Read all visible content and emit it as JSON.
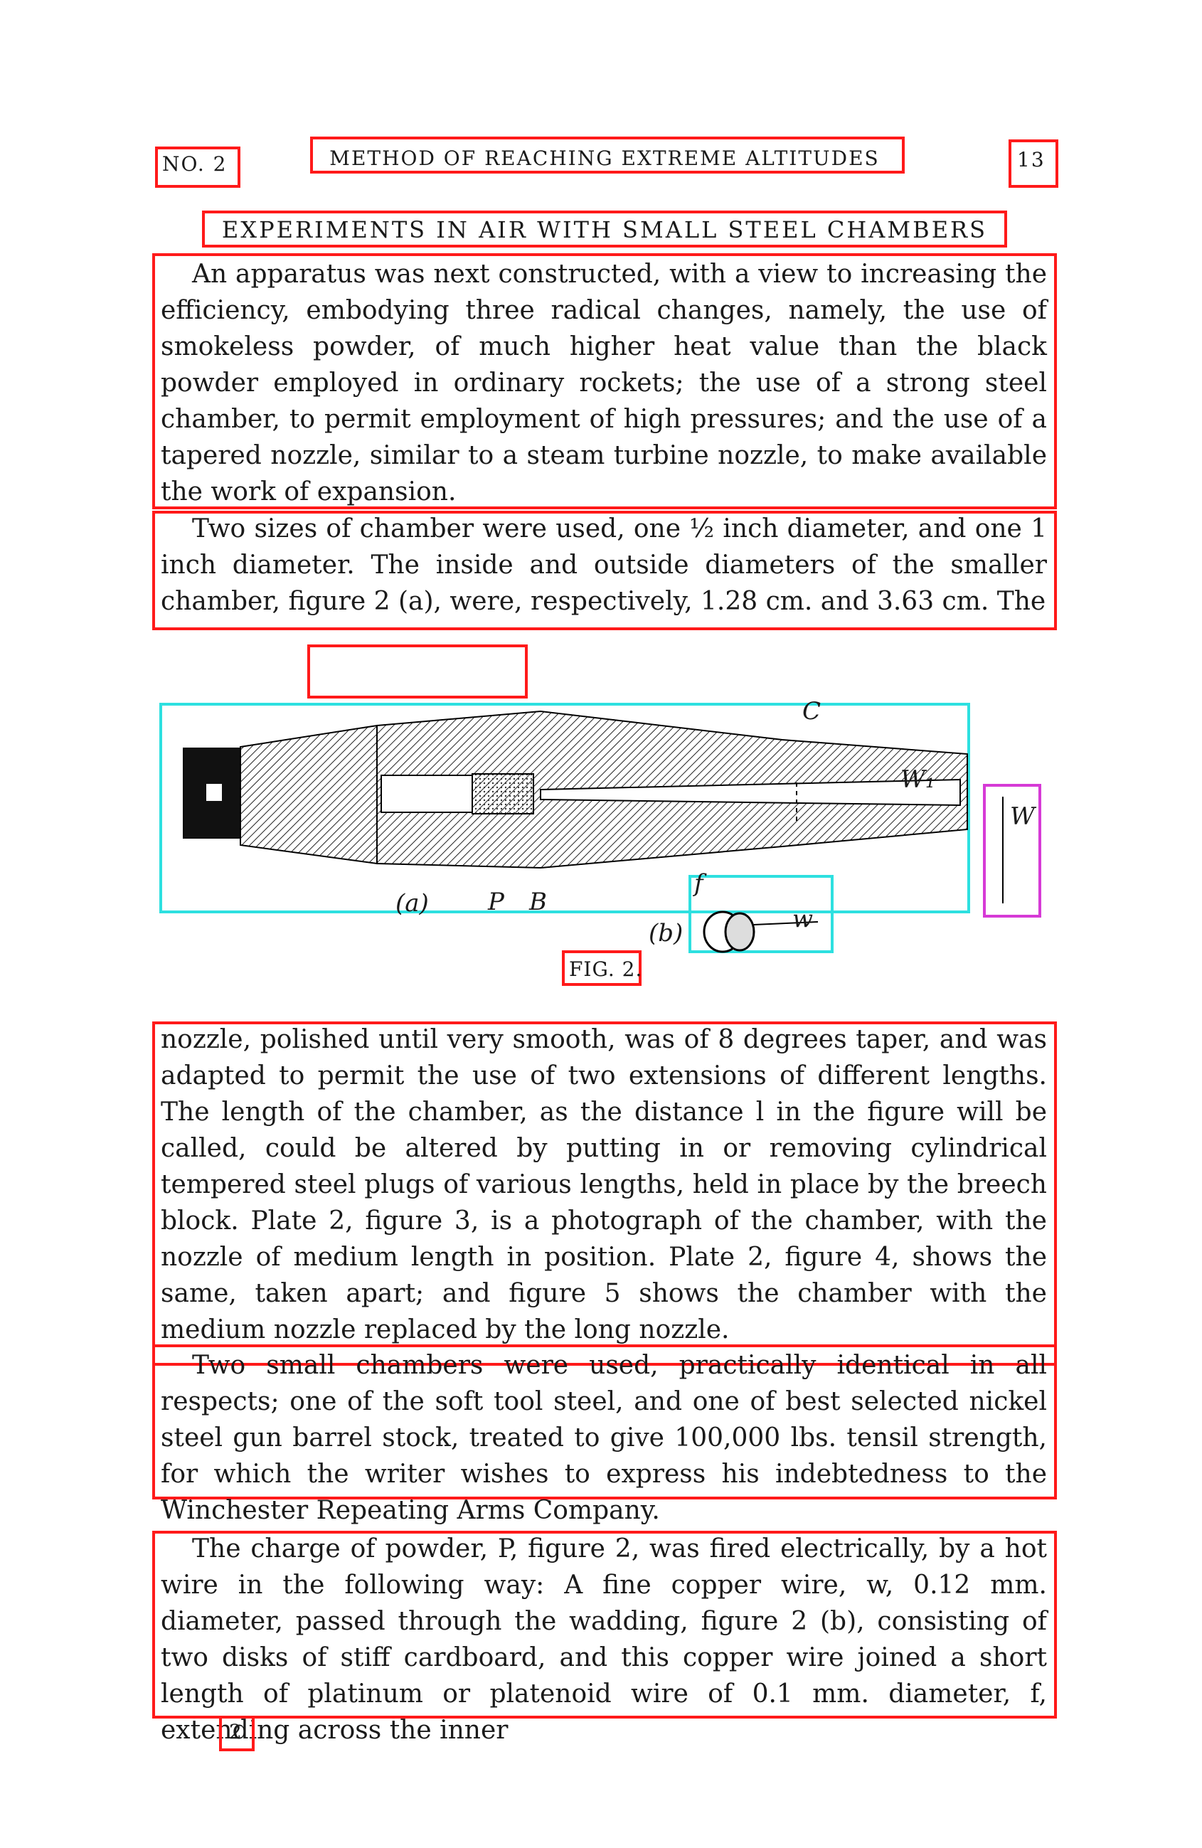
{
  "header": {
    "left": "NO. 2",
    "center": "METHOD OF REACHING EXTREME ALTITUDES",
    "right": "13"
  },
  "section_title": "EXPERIMENTS IN AIR WITH SMALL STEEL CHAMBERS",
  "paragraphs_top": [
    "An apparatus was next constructed, with a view to increasing the efficiency, embodying three radical changes, namely, the use of smokeless powder, of much higher heat value than the black powder employed in ordinary rockets; the use of a strong steel chamber, to permit employment of high pressures; and the use of a tapered nozzle, similar to a steam turbine nozzle, to make available the work of expansion.",
    "Two sizes of chamber were used, one ½ inch diameter, and one 1 inch diameter. The inside and outside diameters of the smaller chamber, figure 2 (a), were, respectively, 1.28 cm. and 3.63 cm. The"
  ],
  "figure": {
    "labels": {
      "c": "C",
      "w1": "W₁",
      "w": "W",
      "a": "(a)",
      "p": "P",
      "b": "B",
      "b_label": "(b)",
      "f": "f",
      "w_small": "w"
    },
    "caption": "FIG. 2."
  },
  "paragraphs_bottom": [
    "nozzle, polished until very smooth, was of 8 degrees taper, and was adapted to permit the use of two extensions of different lengths. The length of the chamber, as the distance l in the figure will be called, could be altered by putting in or removing cylindrical tempered steel plugs of various lengths, held in place by the breech block. Plate 2, figure 3, is a photograph of the chamber, with the nozzle of medium length in position. Plate 2, figure 4, shows the same, taken apart; and figure 5 shows the chamber with the medium nozzle replaced by the long nozzle.",
    "Two small chambers were used, practically identical in all respects; one of the soft tool steel, and one of best selected nickel steel gun barrel stock, treated to give 100,000 lbs. tensil strength, for which the writer wishes to express his indebtedness to the Winchester Repeating Arms Company.",
    "The charge of powder, P, figure 2, was fired electrically, by a hot wire in the following way: A fine copper wire, w, 0.12 mm. diameter, passed through the wadding, figure 2 (b), consisting of two disks of stiff cardboard, and this copper wire joined a short length of platinum or platenoid wire of 0.1 mm. diameter, f, extending across the inner"
  ],
  "footer_signature": "2",
  "colors": {
    "region_text": "#ff1a1a",
    "region_figure": "#2de0e0",
    "region_caption": "#d63ad6",
    "ink": "#1a1a1a"
  }
}
